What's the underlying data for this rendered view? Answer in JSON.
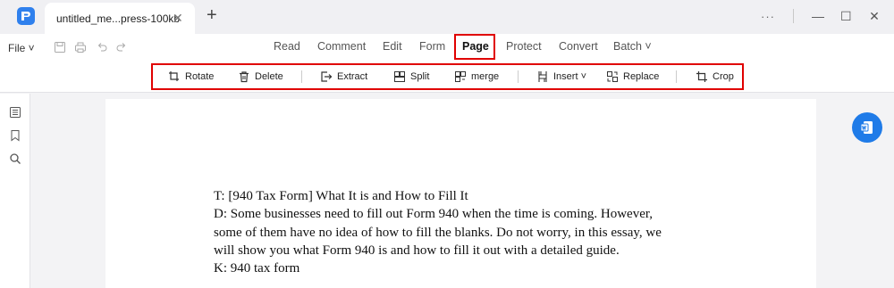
{
  "window": {
    "tab_title": "untitled_me...press-100kb",
    "tab_close": "✕",
    "new_tab": "+",
    "more": "···",
    "minimize": "—",
    "maximize": "☐",
    "close": "✕"
  },
  "menu": {
    "file": "File ˅",
    "items": [
      "Read",
      "Comment",
      "Edit",
      "Form",
      "Page",
      "Protect",
      "Convert",
      "Batch ˅"
    ],
    "active": "Page"
  },
  "toolbar": {
    "rotate": "Rotate",
    "delete": "Delete",
    "extract": "Extract",
    "split": "Split",
    "merge": "merge",
    "insert": "Insert ˅",
    "replace": "Replace",
    "crop": "Crop"
  },
  "document": {
    "lines": [
      "T: [940 Tax Form] What It is and How to Fill It",
      "D: Some businesses need to fill out Form 940 when the time is coming. However,",
      "some of them have no idea of how to fill the blanks. Do not worry, in this essay, we",
      "will show you what Form 940 is and how to fill it out with a detailed guide.",
      "K: 940 tax form"
    ]
  },
  "colors": {
    "accent": "#2f80ed",
    "highlight": "#e00000",
    "fab": "#1f7be8"
  }
}
